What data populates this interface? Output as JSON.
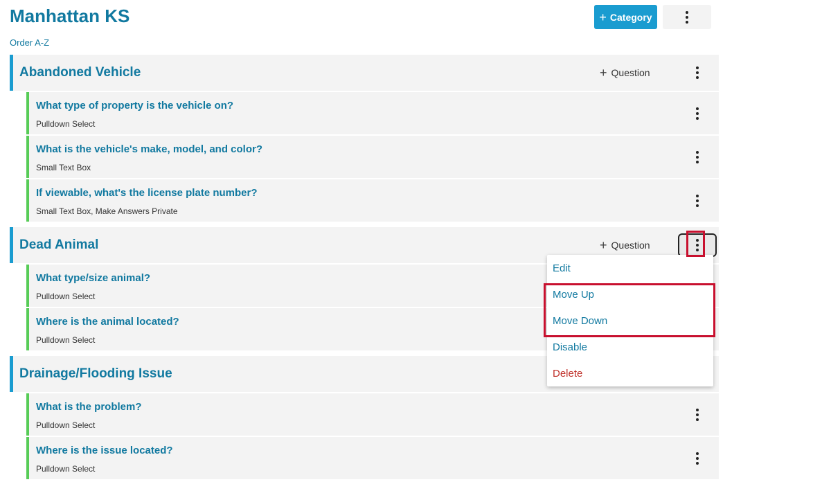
{
  "header": {
    "title": "Manhattan KS",
    "order_link": "Order A-Z",
    "add_category_label": "Category"
  },
  "categories": [
    {
      "title": "Abandoned Vehicle",
      "add_question_label": "Question",
      "questions": [
        {
          "title": "What type of property is the vehicle on?",
          "type": "Pulldown Select"
        },
        {
          "title": "What is the vehicle's make, model, and color?",
          "type": "Small Text Box"
        },
        {
          "title": "If viewable, what's the license plate number?",
          "type": "Small Text Box, Make Answers Private"
        }
      ]
    },
    {
      "title": "Dead Animal",
      "add_question_label": "Question",
      "questions": [
        {
          "title": "What type/size animal?",
          "type": "Pulldown Select"
        },
        {
          "title": "Where is the animal located?",
          "type": "Pulldown Select"
        }
      ]
    },
    {
      "title": "Drainage/Flooding Issue",
      "questions": [
        {
          "title": "What is the problem?",
          "type": "Pulldown Select"
        },
        {
          "title": "Where is the issue located?",
          "type": "Pulldown Select"
        }
      ]
    }
  ],
  "dropdown_menu": {
    "items": [
      "Edit",
      "Move Up",
      "Move Down",
      "Disable",
      "Delete"
    ]
  },
  "icons": {
    "plus": "plus-icon",
    "kebab": "kebab-menu-icon"
  },
  "colors": {
    "accent": "#1a9cd0",
    "title_text": "#1179a0",
    "question_border": "#57cc57",
    "delete": "#c0322b",
    "highlight": "#c8102e"
  }
}
